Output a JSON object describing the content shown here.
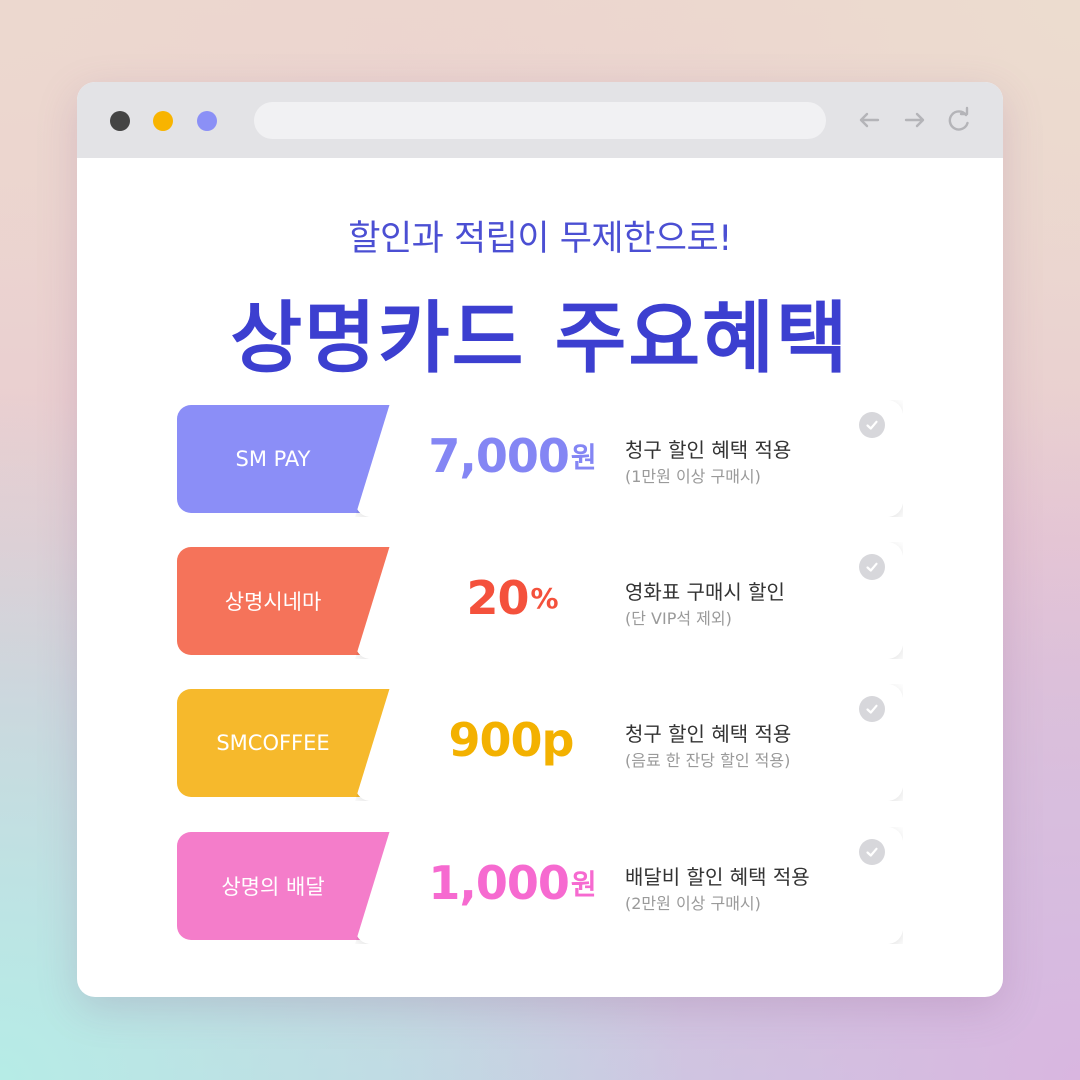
{
  "browser": {
    "dots": [
      "#444444",
      "#f8b400",
      "#8b90f6"
    ],
    "nav_icons": [
      "back-arrow-icon",
      "forward-arrow-icon",
      "reload-icon"
    ]
  },
  "header": {
    "subtitle": "할인과 적립이 무제한으로!",
    "title": "상명카드 주요혜택"
  },
  "benefits": [
    {
      "label": "SM PAY",
      "value": "7,000",
      "unit": "원",
      "desc": "청구 할인 혜택 적용",
      "note": "(1만원 이상 구매시)",
      "color": "#8b8ef7",
      "value_color": "#8486f4"
    },
    {
      "label": "상명시네마",
      "value": "20",
      "unit": "%",
      "desc": "영화표 구매시 할인",
      "note": "(단 VIP석 제외)",
      "color": "#f5735a",
      "value_color": "#f4513c"
    },
    {
      "label": "SMCOFFEE",
      "value": "900p",
      "unit": "",
      "desc": "청구 할인 혜택 적용",
      "note": "(음료 한 잔당 할인 적용)",
      "color": "#f6b92c",
      "value_color": "#f3b100"
    },
    {
      "label": "상명의 배달",
      "value": "1,000",
      "unit": "원",
      "desc": "배달비 할인 혜택 적용",
      "note": "(2만원 이상 구매시)",
      "color": "#f47dca",
      "value_color": "#f66ad0"
    }
  ]
}
